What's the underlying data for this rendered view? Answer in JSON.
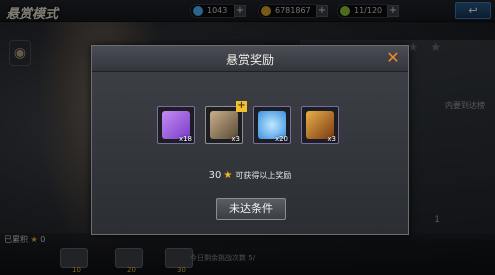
{
  "header": {
    "mode_title": "悬赏模式",
    "diamonds": "1043",
    "gold": "6781867",
    "energy": "11/120",
    "back_symbol": "↩"
  },
  "background": {
    "stars_text": "★ ★",
    "hint_text": "内要到达榜",
    "star_count_label": "已累积",
    "star_count_value": "0",
    "chest_labels": [
      "10",
      "20",
      "30"
    ],
    "bottom_hint": "今日剩余挑战次数",
    "bottom_value": "5/",
    "side_value": "1"
  },
  "dialog": {
    "title": "悬赏奖励",
    "close_symbol": "✕",
    "items": [
      {
        "name": "purple-ticket",
        "qty": "x18",
        "color": "#9a58d6"
      },
      {
        "name": "weapon-rifle",
        "qty": "x3",
        "color": "#7d6a4f",
        "badge": "+"
      },
      {
        "name": "blue-diamond",
        "qty": "x20",
        "color": "#4fb7ff"
      },
      {
        "name": "gold-card",
        "qty": "x3",
        "color": "#c9842a"
      }
    ],
    "requirement_count": "30",
    "requirement_text": "可获得以上奖励",
    "status_button": "未达条件"
  }
}
